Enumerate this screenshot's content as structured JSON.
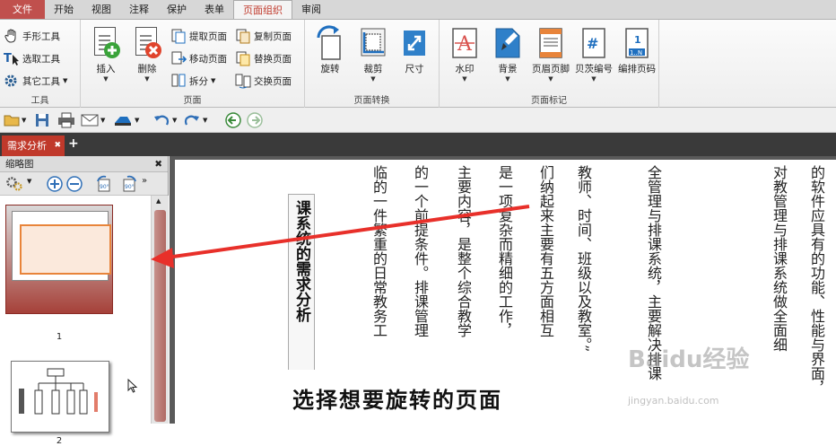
{
  "menu": {
    "tabs": [
      "文件",
      "开始",
      "视图",
      "注释",
      "保护",
      "表单",
      "页面组织",
      "审阅"
    ],
    "active": "页面组织"
  },
  "ribbon": {
    "tools_group": {
      "label": "工具",
      "hand": "手形工具",
      "select": "选取工具",
      "other": "其它工具"
    },
    "page_group": {
      "label": "页面",
      "insert": "插入",
      "delete": "删除",
      "extract": "提取页面",
      "move": "移动页面",
      "split": "拆分",
      "copy": "复制页面",
      "replace": "替换页面",
      "swap": "交换页面"
    },
    "transform_group": {
      "label": "页面转换",
      "rotate": "旋转",
      "crop": "裁剪",
      "size": "尺寸"
    },
    "mark_group": {
      "label": "页面标记",
      "watermark": "水印",
      "background": "背景",
      "header_footer": "页眉页脚",
      "bates": "贝茨编号",
      "page_number": "编排页码"
    }
  },
  "document_tab": {
    "title": "需求分析"
  },
  "thumbnail_panel": {
    "title": "缩略图",
    "pages": [
      {
        "number": "1"
      },
      {
        "number": "2"
      }
    ]
  },
  "document": {
    "title_vertical": "课系统的需求分析",
    "columns": [
      "临的一件繁重的日常教务工",
      "的一个前提条件。排课管理",
      "主要内容，是整个综合教学",
      "是一项复杂而精细的工作，",
      "们纳起来主要有五方面相互",
      "教师、时间、班级以及教室。”",
      "全管理与排课系统，主要解决排课",
      "对教管理与排课系统做全面细",
      "的软件应具有的功能、性能与界面，"
    ],
    "caption": "选择想要旋转的页面",
    "watermark": "Baidu经验",
    "watermark_url": "jingyan.baidu.com"
  },
  "colors": {
    "accent": "#c0392b",
    "file_tab": "#c0504d",
    "highlight": "#e8843a",
    "arrow": "#e8302a"
  }
}
